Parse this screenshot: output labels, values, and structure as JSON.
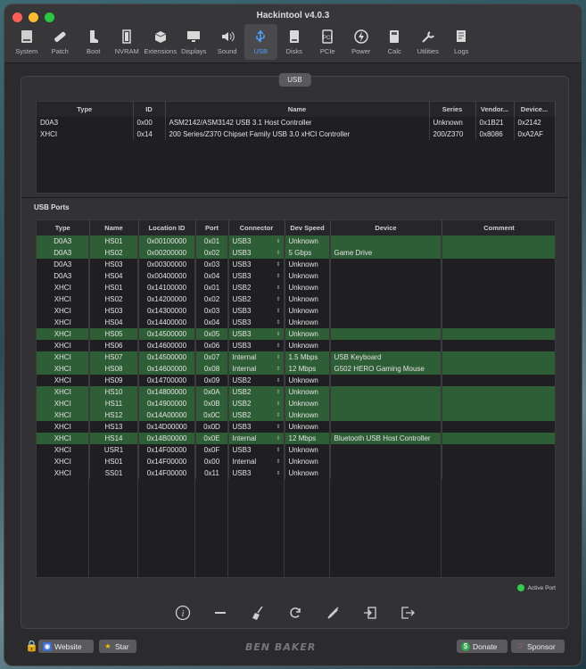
{
  "window": {
    "title": "Hackintool v4.0.3"
  },
  "toolbar": [
    {
      "label": "System",
      "icon": "system-icon"
    },
    {
      "label": "Patch",
      "icon": "patch-icon"
    },
    {
      "label": "Boot",
      "icon": "boot-icon"
    },
    {
      "label": "NVRAM",
      "icon": "nvram-icon"
    },
    {
      "label": "Extensions",
      "icon": "extensions-icon"
    },
    {
      "label": "Displays",
      "icon": "displays-icon"
    },
    {
      "label": "Sound",
      "icon": "sound-icon"
    },
    {
      "label": "USB",
      "icon": "usb-icon",
      "active": true
    },
    {
      "label": "Disks",
      "icon": "disks-icon"
    },
    {
      "label": "PCIe",
      "icon": "pcie-icon"
    },
    {
      "label": "Power",
      "icon": "power-icon"
    },
    {
      "label": "Calc",
      "icon": "calc-icon"
    },
    {
      "label": "Utilities",
      "icon": "utilities-icon"
    },
    {
      "label": "Logs",
      "icon": "logs-icon"
    }
  ],
  "segment_label": "USB",
  "controllers": {
    "headers": [
      "Type",
      "ID",
      "Name",
      "Series",
      "Vendor...",
      "Device..."
    ],
    "rows": [
      [
        "D0A3",
        "0x00",
        "ASM2142/ASM3142 USB 3.1 Host Controller",
        "Unknown",
        "0x1B21",
        "0x2142"
      ],
      [
        "XHCI",
        "0x14",
        "200 Series/Z370 Chipset Family USB 3.0 xHCI Controller",
        "200/Z370",
        "0x8086",
        "0xA2AF"
      ]
    ]
  },
  "ports_label": "USB Ports",
  "ports": {
    "headers": [
      "Type",
      "Name",
      "Location ID",
      "Port",
      "Connector",
      "Dev Speed",
      "Device",
      "Comment"
    ],
    "rows": [
      {
        "type": "D0A3",
        "name": "HS01",
        "location": "0x00100000",
        "port": "0x01",
        "connector": "USB3",
        "speed": "Unknown",
        "device": "",
        "comment": "",
        "active": true
      },
      {
        "type": "D0A3",
        "name": "HS02",
        "location": "0x00200000",
        "port": "0x02",
        "connector": "USB3",
        "speed": "5 Gbps",
        "device": "Game Drive",
        "comment": "",
        "active": true
      },
      {
        "type": "D0A3",
        "name": "HS03",
        "location": "0x00300000",
        "port": "0x03",
        "connector": "USB3",
        "speed": "Unknown",
        "device": "",
        "comment": "",
        "active": false
      },
      {
        "type": "D0A3",
        "name": "HS04",
        "location": "0x00400000",
        "port": "0x04",
        "connector": "USB3",
        "speed": "Unknown",
        "device": "",
        "comment": "",
        "active": false
      },
      {
        "type": "XHCI",
        "name": "HS01",
        "location": "0x14100000",
        "port": "0x01",
        "connector": "USB2",
        "speed": "Unknown",
        "device": "",
        "comment": "",
        "active": false
      },
      {
        "type": "XHCI",
        "name": "HS02",
        "location": "0x14200000",
        "port": "0x02",
        "connector": "USB2",
        "speed": "Unknown",
        "device": "",
        "comment": "",
        "active": false
      },
      {
        "type": "XHCI",
        "name": "HS03",
        "location": "0x14300000",
        "port": "0x03",
        "connector": "USB3",
        "speed": "Unknown",
        "device": "",
        "comment": "",
        "active": false
      },
      {
        "type": "XHCI",
        "name": "HS04",
        "location": "0x14400000",
        "port": "0x04",
        "connector": "USB3",
        "speed": "Unknown",
        "device": "",
        "comment": "",
        "active": false
      },
      {
        "type": "XHCI",
        "name": "HS05",
        "location": "0x14500000",
        "port": "0x05",
        "connector": "USB3",
        "speed": "Unknown",
        "device": "",
        "comment": "",
        "active": true
      },
      {
        "type": "XHCI",
        "name": "HS06",
        "location": "0x14600000",
        "port": "0x06",
        "connector": "USB3",
        "speed": "Unknown",
        "device": "",
        "comment": "",
        "active": false
      },
      {
        "type": "XHCI",
        "name": "HS07",
        "location": "0x14500000",
        "port": "0x07",
        "connector": "Internal",
        "speed": "1.5 Mbps",
        "device": "USB Keyboard",
        "comment": "",
        "active": true
      },
      {
        "type": "XHCI",
        "name": "HS08",
        "location": "0x14600000",
        "port": "0x08",
        "connector": "Internal",
        "speed": "12 Mbps",
        "device": "G502 HERO Gaming Mouse",
        "comment": "",
        "active": true
      },
      {
        "type": "XHCI",
        "name": "HS09",
        "location": "0x14700000",
        "port": "0x09",
        "connector": "USB2",
        "speed": "Unknown",
        "device": "",
        "comment": "",
        "active": false
      },
      {
        "type": "XHCI",
        "name": "HS10",
        "location": "0x14800000",
        "port": "0x0A",
        "connector": "USB2",
        "speed": "Unknown",
        "device": "",
        "comment": "",
        "active": true
      },
      {
        "type": "XHCI",
        "name": "HS11",
        "location": "0x14900000",
        "port": "0x0B",
        "connector": "USB2",
        "speed": "Unknown",
        "device": "",
        "comment": "",
        "active": true
      },
      {
        "type": "XHCI",
        "name": "HS12",
        "location": "0x14A00000",
        "port": "0x0C",
        "connector": "USB2",
        "speed": "Unknown",
        "device": "",
        "comment": "",
        "active": true
      },
      {
        "type": "XHCI",
        "name": "HS13",
        "location": "0x14D00000",
        "port": "0x0D",
        "connector": "USB3",
        "speed": "Unknown",
        "device": "",
        "comment": "",
        "active": false
      },
      {
        "type": "XHCI",
        "name": "HS14",
        "location": "0x14B00000",
        "port": "0x0E",
        "connector": "Internal",
        "speed": "12 Mbps",
        "device": "Bluetooth USB Host Controller",
        "comment": "",
        "active": true
      },
      {
        "type": "XHCI",
        "name": "USR1",
        "location": "0x14F00000",
        "port": "0x0F",
        "connector": "USB3",
        "speed": "Unknown",
        "device": "",
        "comment": "",
        "active": false
      },
      {
        "type": "XHCI",
        "name": "HS01",
        "location": "0x14F00000",
        "port": "0x00",
        "connector": "Internal",
        "speed": "Unknown",
        "device": "",
        "comment": "",
        "active": false
      },
      {
        "type": "XHCI",
        "name": "SS01",
        "location": "0x14F00000",
        "port": "0x11",
        "connector": "USB3",
        "speed": "Unknown",
        "device": "",
        "comment": "",
        "active": false
      }
    ]
  },
  "legend": {
    "label": "Active Port",
    "color": "#2fcf4c"
  },
  "actions": [
    "info-icon",
    "minus-icon",
    "broom-icon",
    "refresh-icon",
    "injector-icon",
    "import-icon",
    "export-icon"
  ],
  "footer": {
    "website_label": "Website",
    "star_label": "Star",
    "brand": "BEN BAKER",
    "donate_label": "Donate",
    "sponsor_label": "Sponsor"
  },
  "colors": {
    "active_row": "#2e5e35",
    "accent": "#4ea1ff"
  }
}
